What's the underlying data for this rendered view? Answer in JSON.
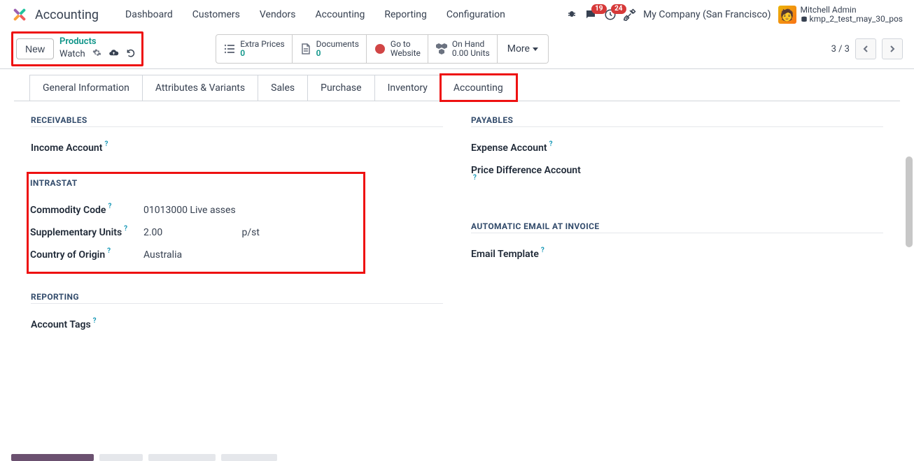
{
  "app_title": "Accounting",
  "nav": [
    "Dashboard",
    "Customers",
    "Vendors",
    "Accounting",
    "Reporting",
    "Configuration"
  ],
  "badges": {
    "messages": "19",
    "activities": "24"
  },
  "company": "My Company (San Francisco)",
  "user": {
    "name": "Mitchell Admin",
    "db": "kmp_2_test_may_30_pos"
  },
  "breadcrumb": {
    "top": "Products",
    "current": "Watch"
  },
  "new_label": "New",
  "stats": {
    "extra_prices": {
      "label": "Extra Prices",
      "value": "0"
    },
    "documents": {
      "label": "Documents",
      "value": "0"
    },
    "goto": {
      "line1": "Go to",
      "line2": "Website"
    },
    "onhand": {
      "label": "On Hand",
      "value": "0.00 Units"
    },
    "more": "More"
  },
  "pager": "3 / 3",
  "tabs": [
    "General Information",
    "Attributes & Variants",
    "Sales",
    "Purchase",
    "Inventory",
    "Accounting"
  ],
  "sections": {
    "receivables": "RECEIVABLES",
    "payables": "PAYABLES",
    "intrastat": "INTRASTAT",
    "auto_email": "AUTOMATIC EMAIL AT INVOICE",
    "reporting": "REPORTING"
  },
  "fields": {
    "income_account": "Income Account",
    "expense_account": "Expense Account",
    "price_diff": "Price Difference Account",
    "commodity_code": "Commodity Code",
    "commodity_code_val": "01013000 Live asses",
    "supp_units": "Supplementary Units",
    "supp_units_val": "2.00",
    "supp_units_unit": "p/st",
    "country_origin": "Country of Origin",
    "country_origin_val": "Australia",
    "email_template": "Email Template",
    "account_tags": "Account Tags"
  }
}
